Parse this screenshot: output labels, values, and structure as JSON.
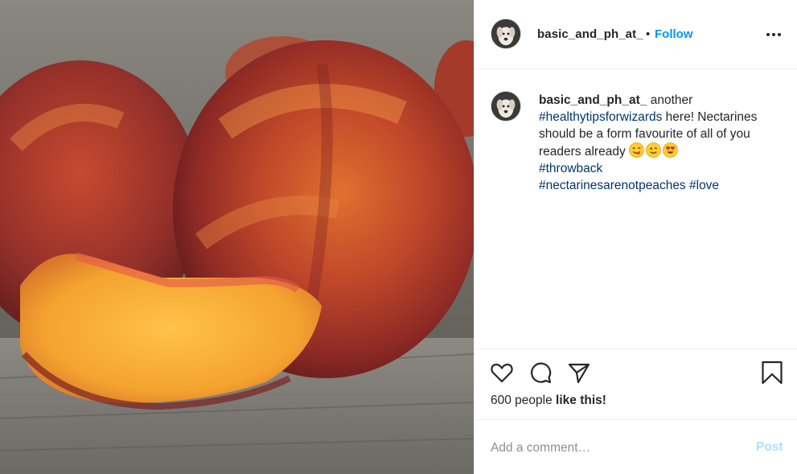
{
  "post": {
    "photo_alt": "",
    "header": {
      "username": "basic_and_ph_at_",
      "separator": "•",
      "follow_label": "Follow",
      "more_icon": "more-horizontal-icon"
    },
    "caption": {
      "username": "basic_and_ph_at_",
      "text_1": " another ",
      "hashtag_1": "#healthytipsforwizards",
      "text_2": " here! Nectarines should be a form favourite of all of you readers already ",
      "emojis": [
        "yum-face",
        "wink-face",
        "heart-eyes-face"
      ],
      "hashtag_2": "#throwback",
      "hashtag_3": "#nectarinesarenotpeaches",
      "hashtag_4": "#love"
    },
    "actions": {
      "like_icon": "heart-icon",
      "comment_icon": "comment-icon",
      "share_icon": "send-icon",
      "save_icon": "bookmark-icon",
      "likes_count": "600 people",
      "likes_suffix": "like this!"
    },
    "comment": {
      "placeholder": "Add a comment…",
      "post_label": "Post"
    },
    "colors": {
      "link_blue": "#0095f6",
      "hashtag": "#00376b",
      "post_disabled": "#b2dffc",
      "text": "#262626",
      "muted": "#8e8e8e"
    }
  }
}
